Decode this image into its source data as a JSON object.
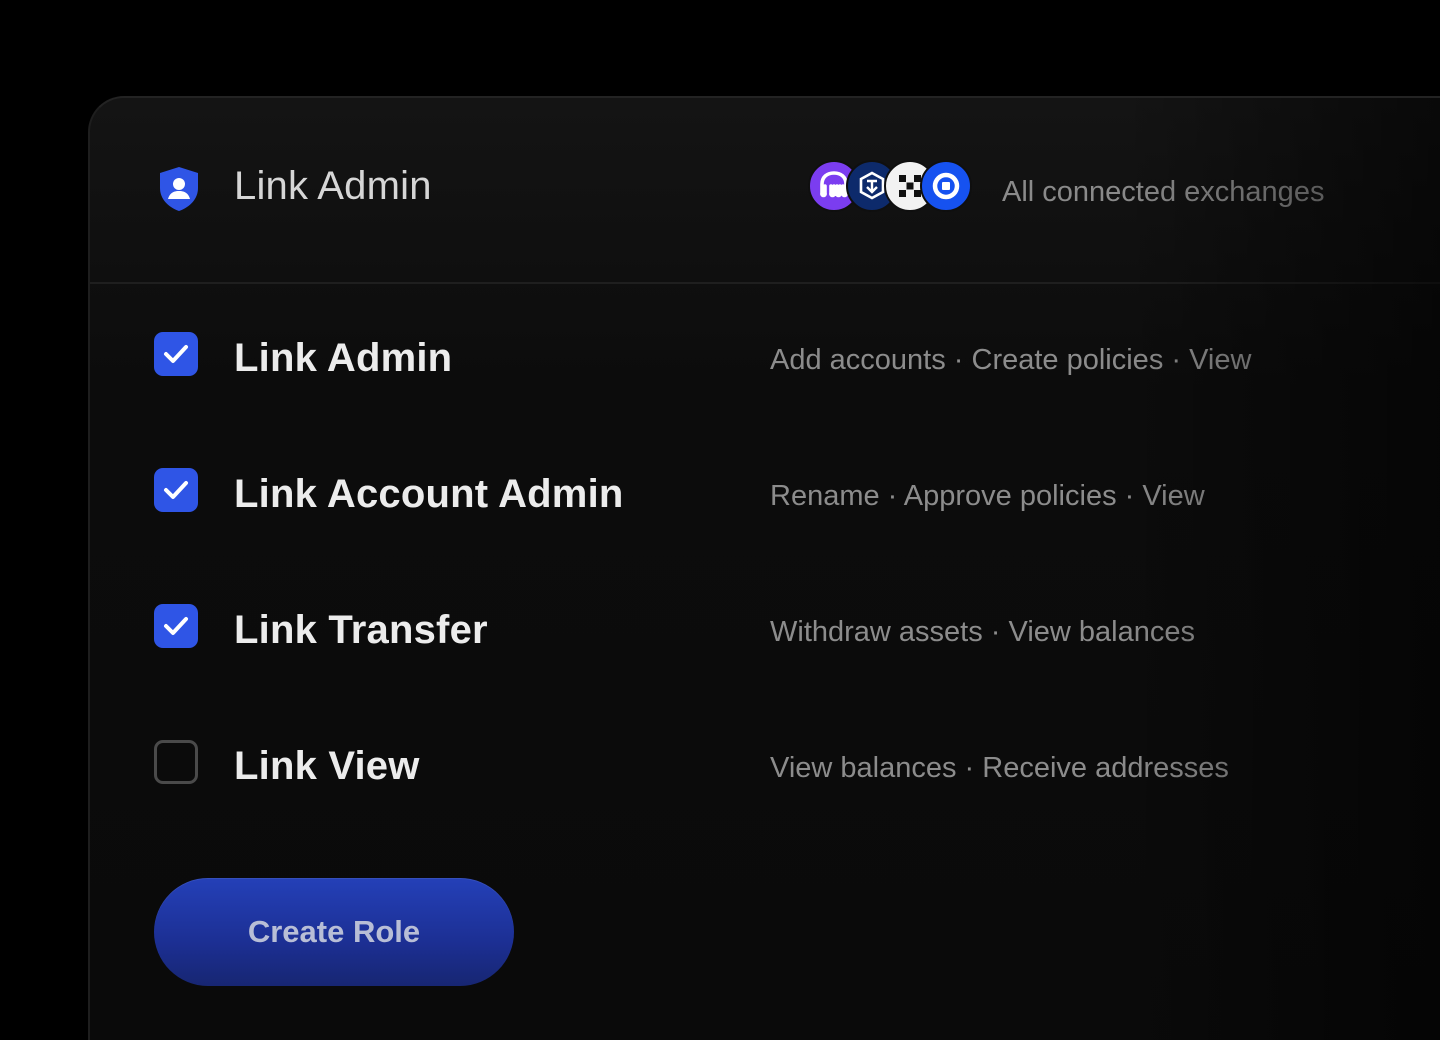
{
  "header": {
    "title": "Link Admin",
    "scope": "All connected exchanges",
    "logos": [
      {
        "icon": "kraken-logo-icon",
        "color": "#7b3df0"
      },
      {
        "icon": "crypto-com-logo-icon",
        "color": "#0d2a6b"
      },
      {
        "icon": "okx-logo-icon",
        "color": "#f2f2f2"
      },
      {
        "icon": "coinbase-logo-icon",
        "color": "#1652f0"
      }
    ]
  },
  "roles": [
    {
      "label": "Link Admin",
      "description": "Add accounts · Create policies · View",
      "checked": true
    },
    {
      "label": "Link Account Admin",
      "description": "Rename · Approve policies · View",
      "checked": true
    },
    {
      "label": "Link Transfer",
      "description": "Withdraw assets · View balances",
      "checked": true
    },
    {
      "label": "Link View",
      "description": "View balances · Receive addresses",
      "checked": false
    }
  ],
  "actions": {
    "create_label": "Create Role"
  },
  "colors": {
    "accent": "#2f55e6",
    "background": "#000000",
    "panel": "#0c0c0c"
  }
}
